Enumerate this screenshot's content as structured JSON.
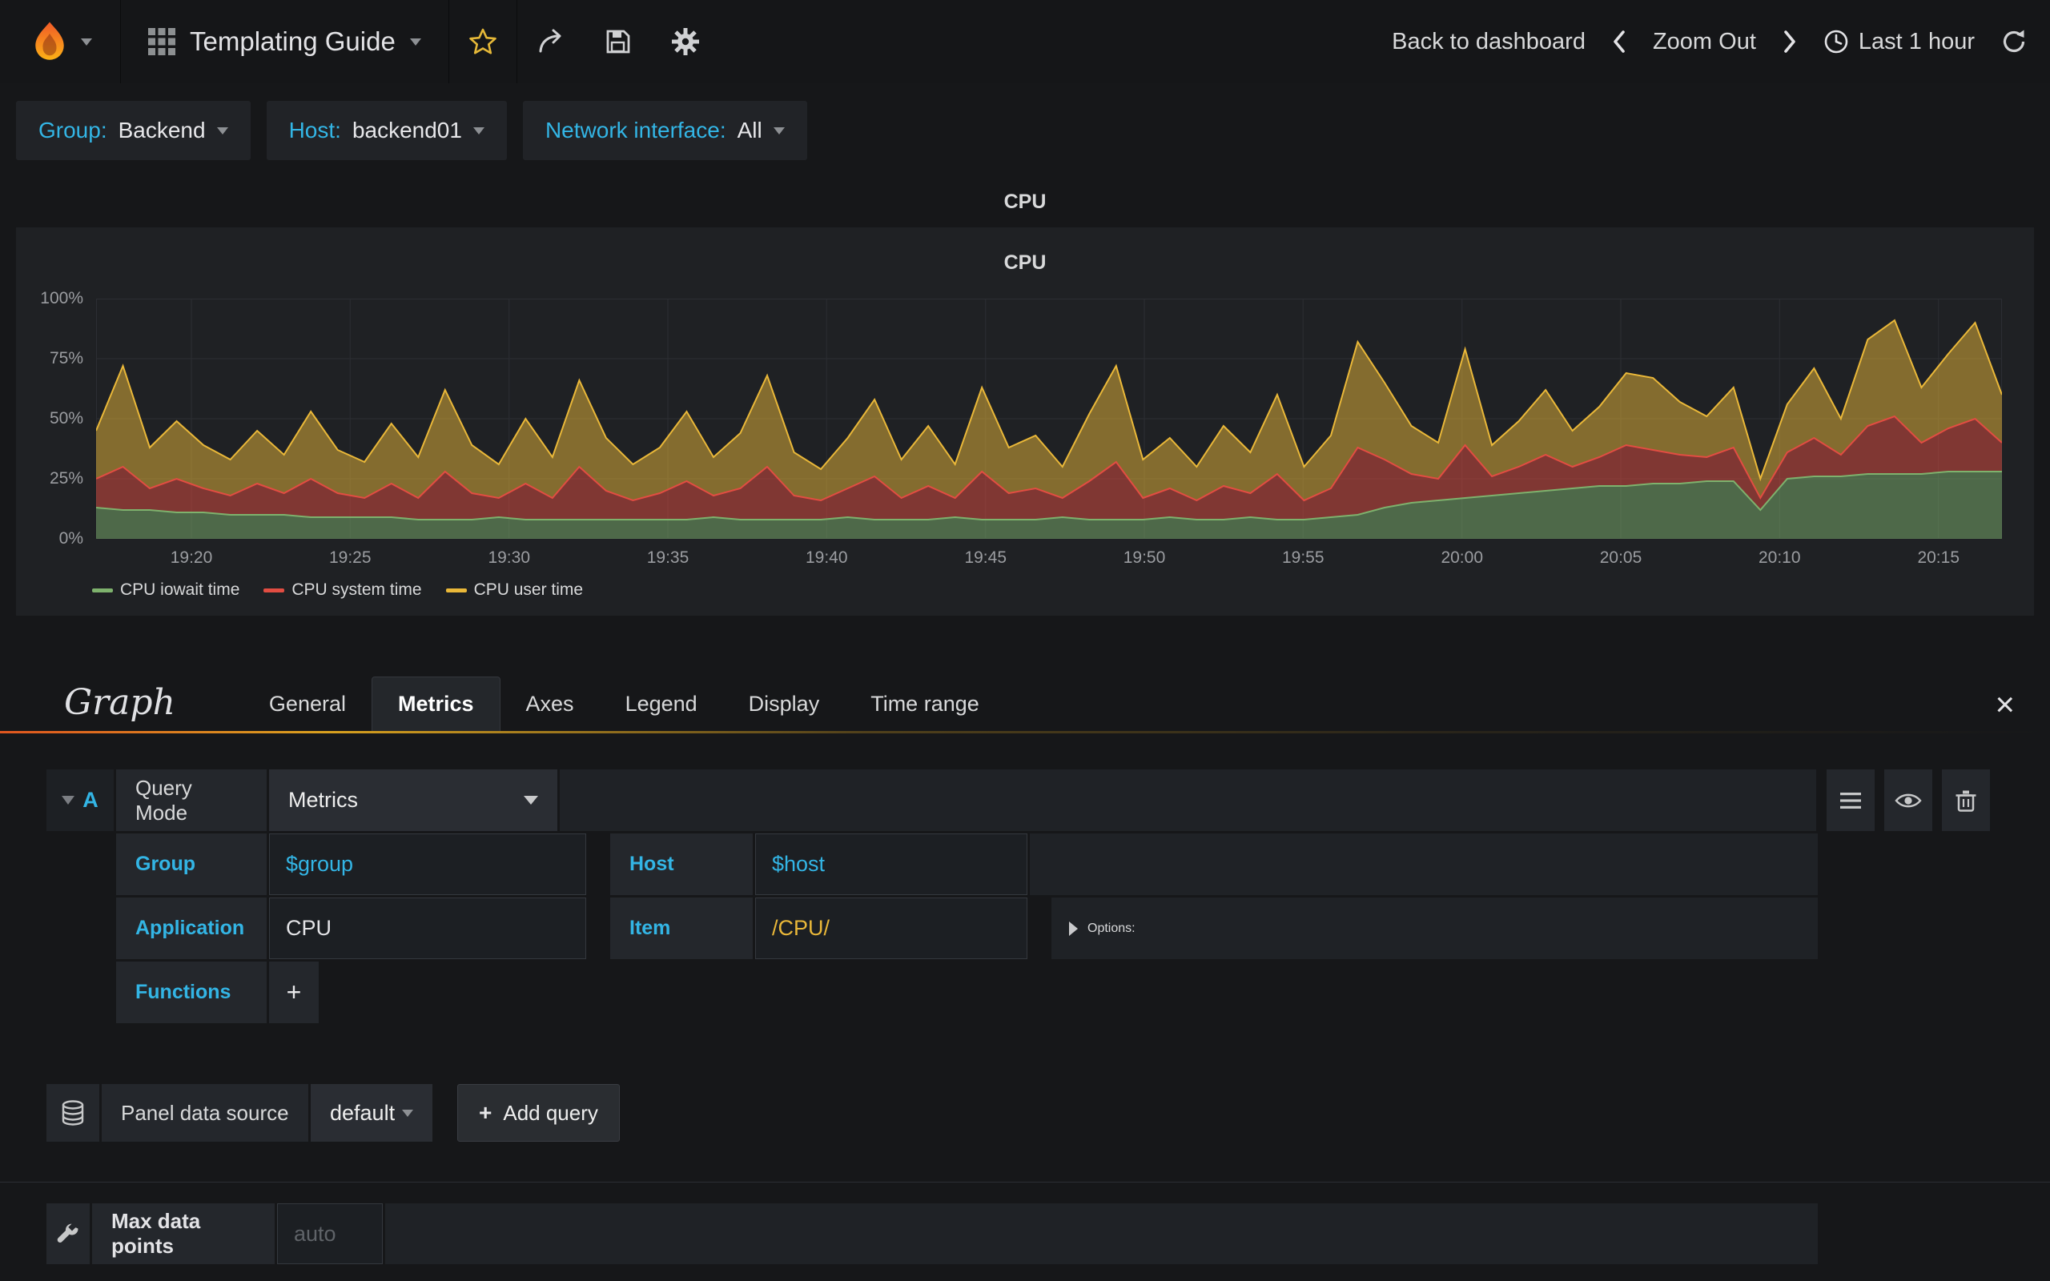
{
  "colors": {
    "accent_blue": "#33b5e5",
    "accent_yellow": "#eab839",
    "star_yellow": "#e5b838"
  },
  "icons": {
    "plus": "+",
    "close": "×"
  },
  "navbar": {
    "title": "Templating Guide",
    "back_to_dashboard": "Back to dashboard",
    "zoom_out": "Zoom Out",
    "time_range": "Last 1 hour"
  },
  "variables": [
    {
      "label": "Group:",
      "value": "Backend"
    },
    {
      "label": "Host:",
      "value": "backend01"
    },
    {
      "label": "Network interface:",
      "value": "All"
    }
  ],
  "panel": {
    "title": "CPU"
  },
  "chart_data": {
    "type": "area",
    "stacked": true,
    "title": "CPU",
    "ylim": [
      0,
      100
    ],
    "grid": true,
    "legend_position": "bottom-left",
    "y_ticks": [
      "100%",
      "75%",
      "50%",
      "25%",
      "0%"
    ],
    "x_ticks": [
      "19:20",
      "19:25",
      "19:30",
      "19:35",
      "19:40",
      "19:45",
      "19:50",
      "19:55",
      "20:00",
      "20:05",
      "20:10",
      "20:15"
    ],
    "x_tick_positions": [
      0.05,
      0.1333,
      0.2167,
      0.3,
      0.3833,
      0.4667,
      0.55,
      0.6333,
      0.7167,
      0.8,
      0.8833,
      0.9667
    ],
    "series": [
      {
        "name": "CPU iowait time",
        "color": "#7eb26d",
        "values": [
          13,
          12,
          12,
          11,
          11,
          10,
          10,
          10,
          9,
          9,
          9,
          9,
          8,
          8,
          8,
          9,
          8,
          8,
          8,
          8,
          8,
          8,
          8,
          9,
          8,
          8,
          8,
          8,
          9,
          8,
          8,
          8,
          9,
          8,
          8,
          8,
          9,
          8,
          8,
          8,
          9,
          8,
          8,
          9,
          8,
          8,
          9,
          10,
          13,
          15,
          16,
          17,
          18,
          19,
          20,
          21,
          22,
          22,
          23,
          23,
          24,
          24,
          12,
          25,
          26,
          26,
          27,
          27,
          27,
          28,
          28,
          28
        ]
      },
      {
        "name": "CPU system time",
        "color": "#e24d42",
        "values": [
          12,
          18,
          9,
          14,
          10,
          8,
          13,
          9,
          16,
          10,
          8,
          14,
          9,
          20,
          11,
          8,
          15,
          9,
          22,
          12,
          8,
          11,
          16,
          9,
          13,
          22,
          10,
          8,
          12,
          18,
          9,
          14,
          8,
          20,
          11,
          13,
          8,
          16,
          24,
          9,
          12,
          8,
          14,
          10,
          19,
          8,
          12,
          28,
          20,
          12,
          9,
          22,
          8,
          11,
          15,
          9,
          12,
          17,
          14,
          12,
          10,
          14,
          5,
          11,
          16,
          9,
          20,
          24,
          13,
          18,
          22,
          12
        ]
      },
      {
        "name": "CPU user time",
        "color": "#eab839",
        "values": [
          20,
          42,
          17,
          24,
          18,
          15,
          22,
          16,
          28,
          18,
          15,
          25,
          17,
          34,
          20,
          14,
          27,
          17,
          36,
          22,
          15,
          19,
          29,
          16,
          23,
          38,
          18,
          13,
          21,
          32,
          16,
          25,
          14,
          35,
          19,
          22,
          13,
          28,
          40,
          16,
          21,
          14,
          25,
          17,
          33,
          14,
          22,
          44,
          32,
          20,
          15,
          40,
          13,
          19,
          27,
          15,
          21,
          30,
          30,
          22,
          17,
          25,
          8,
          20,
          29,
          15,
          36,
          40,
          23,
          31,
          40,
          20
        ]
      }
    ]
  },
  "editor": {
    "panel_type": "Graph",
    "tabs": [
      "General",
      "Metrics",
      "Axes",
      "Legend",
      "Display",
      "Time range"
    ],
    "active_tab": "Metrics",
    "query": {
      "collapse": "A",
      "mode_label": "Query Mode",
      "mode_value": "Metrics",
      "group_label": "Group",
      "group_value": "$group",
      "host_label": "Host",
      "host_value": "$host",
      "app_label": "Application",
      "app_value": "CPU",
      "item_label": "Item",
      "item_value": "/CPU/",
      "options_label": "Options:",
      "functions_label": "Functions"
    },
    "datasource": {
      "label": "Panel data source",
      "value": "default",
      "add_query_label": "Add query"
    },
    "max_data_points": {
      "label": "Max data points",
      "placeholder": "auto"
    }
  }
}
